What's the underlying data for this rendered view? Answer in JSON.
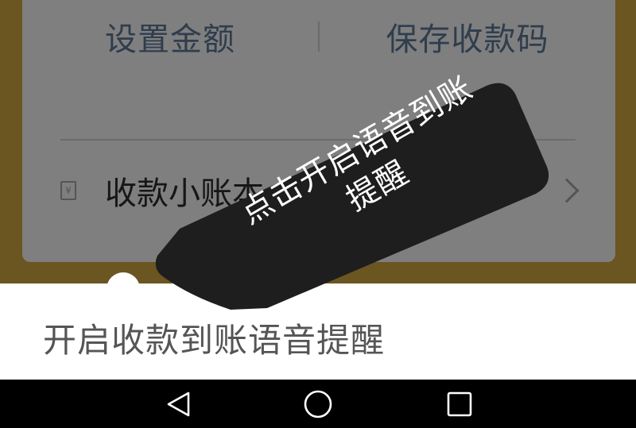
{
  "card": {
    "actions": [
      {
        "label": "设置金额"
      },
      {
        "label": "保存收款码"
      }
    ],
    "ledger_row": {
      "icon": "ledger-icon",
      "icon_glyph": "¥",
      "label": "收款小账本",
      "chevron": "chevron-right-icon"
    }
  },
  "tooltip": {
    "line1": "点击开启语音到账",
    "line2": "提醒"
  },
  "sheet": {
    "label": "开启收款到账语音提醒"
  },
  "navbar": {
    "buttons": [
      {
        "icon": "back-triangle-icon"
      },
      {
        "icon": "home-circle-icon"
      },
      {
        "icon": "recents-square-icon"
      }
    ]
  },
  "colors": {
    "background": "#6b5521",
    "overlay_card": "#7f7f7f",
    "action_text": "#2f3d4e",
    "tooltip_bg": "#1e1e1e",
    "sheet_bg": "#ffffff",
    "sheet_text": "#555555",
    "navbar_bg": "#000000"
  }
}
